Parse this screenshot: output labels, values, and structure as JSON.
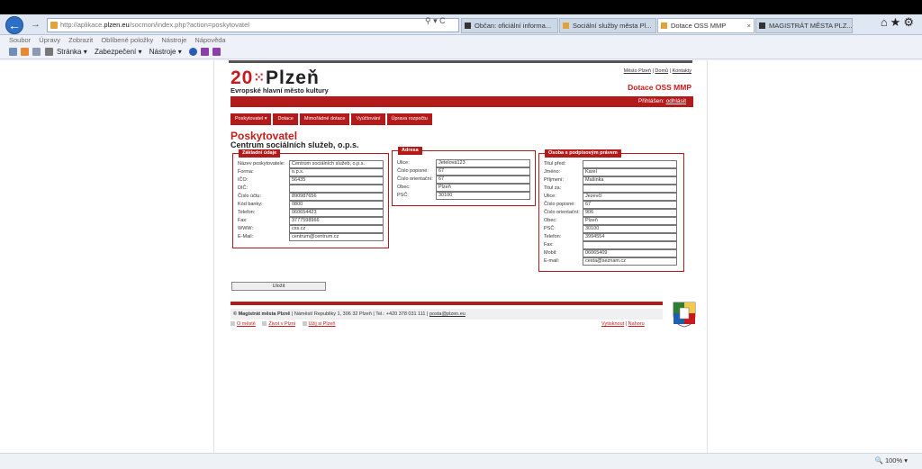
{
  "browser": {
    "url_prefix": "http://aplikace.",
    "url_domain": "plzen.eu",
    "url_path": "/socmon/index.php?action=poskytovatel",
    "url_controls": "⚲ ▾ C",
    "tabs": [
      {
        "label": "Občan: oficiální informa...",
        "active": false
      },
      {
        "label": "Sociální služby města Pl...",
        "active": false
      },
      {
        "label": "Dotace OSS MMP",
        "active": true
      },
      {
        "label": "MAGISTRÁT MĚSTA PLZ...",
        "active": false
      }
    ],
    "tab_close": "×",
    "back_glyph": "←",
    "forward_glyph": "→",
    "right_icons": "⌂★⚙"
  },
  "menubar": [
    "Soubor",
    "Úpravy",
    "Zobrazit",
    "Oblíbené položky",
    "Nástroje",
    "Nápověda"
  ],
  "commandbar": {
    "page": "Stránka ▾",
    "safety": "Zabezpečení ▾",
    "tools": "Nástroje ▾"
  },
  "site": {
    "logo_num": "20",
    "logo_dots": "⁙",
    "logo_city": "Plzeň",
    "slogan": "Evropské hlavní město kultury",
    "toplinks": [
      "Město Plzeň",
      "Domů",
      "Kontakty"
    ],
    "toplink_sep": "|",
    "app_title": "Dotace OSS MMP",
    "login_label": "Přihlášen:",
    "login_link": "odhlásit",
    "menu": [
      "Poskytovatel ▾",
      "Dotace",
      "Mimořádné dotace",
      "Vyúčtování",
      "Úprava rozpočtu"
    ],
    "heading": "Poskytovatel",
    "subheading": "Centrum sociálních služeb, o.p.s.",
    "save_label": "Uložit"
  },
  "basic": {
    "legend": "Základní údaje",
    "rows": [
      {
        "label": "Název poskytovatele:",
        "value": "Centrum sociálních služeb, o.p.s."
      },
      {
        "label": "Forma:",
        "value": "o.p.s."
      },
      {
        "label": "IČO:",
        "value": "56435"
      },
      {
        "label": "DIČ:",
        "value": ""
      },
      {
        "label": "Číslo účtu:",
        "value": "890987656"
      },
      {
        "label": "Kód banky:",
        "value": "0800"
      },
      {
        "label": "Telefon:",
        "value": "060654423"
      },
      {
        "label": "Fax:",
        "value": "3777598966"
      },
      {
        "label": "WWW:",
        "value": "css.cz"
      },
      {
        "label": "E-Mail:",
        "value": "centrum@centrum.cz"
      }
    ]
  },
  "address": {
    "legend": "Adresa",
    "rows": [
      {
        "label": "Ulice:",
        "value": "Jetelová123"
      },
      {
        "label": "Číslo popisné:",
        "value": "67"
      },
      {
        "label": "Číslo orientační:",
        "value": "67"
      },
      {
        "label": "Obec:",
        "value": "Plzeň"
      },
      {
        "label": "PSČ:",
        "value": "30100"
      }
    ]
  },
  "person": {
    "legend": "Osoba s podpisovým právem",
    "rows": [
      {
        "label": "Titul před:",
        "value": ""
      },
      {
        "label": "Jméno:",
        "value": "Karel"
      },
      {
        "label": "Příjmení:",
        "value": "Mašinka"
      },
      {
        "label": "Titul za:",
        "value": ""
      },
      {
        "label": "Ulice:",
        "value": "Jezevčí"
      },
      {
        "label": "Číslo popisné:",
        "value": "67"
      },
      {
        "label": "Číslo orientační:",
        "value": "906"
      },
      {
        "label": "Obec:",
        "value": "Plzeň"
      },
      {
        "label": "PSČ:",
        "value": "30100"
      },
      {
        "label": "Telefon:",
        "value": "3994554"
      },
      {
        "label": "Fax:",
        "value": ""
      },
      {
        "label": "Mobil:",
        "value": "06065409"
      },
      {
        "label": "E-mail:",
        "value": "cesta@seznam.cz"
      }
    ]
  },
  "footer": {
    "org": "© Magistrát města Plzně",
    "address": "Náměstí Republiky 1, 306 32 Plzeň",
    "phone": "Tel.: +420 378 031 111",
    "email": "posta@plzen.eu",
    "sep": "|",
    "links": [
      "O městě",
      "Život v Plzni",
      "Užij si Plzeň"
    ],
    "print": "Vytisknout",
    "up": "Nahoru"
  },
  "statusbar": {
    "zoom": "🔍 100% ▾"
  }
}
